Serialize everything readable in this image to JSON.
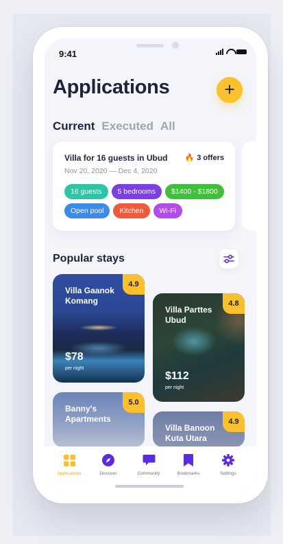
{
  "status_bar": {
    "time": "9:41"
  },
  "header": {
    "title": "Applications",
    "add_label": "+"
  },
  "tabs": [
    {
      "label": "Current",
      "active": true
    },
    {
      "label": "Executed",
      "active": false
    },
    {
      "label": "All",
      "active": false
    }
  ],
  "application_card": {
    "title": "Villa for 16 guests in Ubud",
    "offers": "3 offers",
    "dates": "Nov 20, 2020 — Dec 4, 2020",
    "chips": [
      {
        "label": "16 guests",
        "color": "#2ec4a6"
      },
      {
        "label": "5 bedrooms",
        "color": "#7b3fe4"
      },
      {
        "label": "$1400 - $1800",
        "color": "#3fbf3a"
      },
      {
        "label": "Open pool",
        "color": "#3d8be8"
      },
      {
        "label": "Kitchen",
        "color": "#ef5b3a"
      },
      {
        "label": "Wi-Fi",
        "color": "#b44be8"
      }
    ]
  },
  "popular": {
    "title": "Popular stays",
    "stays": [
      {
        "name": "Villa Gaanok Komang",
        "rating": "4.9",
        "price": "$78",
        "per": "per night"
      },
      {
        "name": "Villa Parttes Ubud",
        "rating": "4.8",
        "price": "$112",
        "per": "per night"
      },
      {
        "name": "Banny's Apartments",
        "rating": "5.0"
      },
      {
        "name": "Villa Banoon Kuta Utara",
        "rating": "4.9"
      }
    ]
  },
  "tabbar": {
    "items": [
      {
        "label": "Applications",
        "icon": "grid-icon"
      },
      {
        "label": "Discover",
        "icon": "compass-icon"
      },
      {
        "label": "Community",
        "icon": "chat-icon"
      },
      {
        "label": "Bookmarks",
        "icon": "bookmark-icon"
      },
      {
        "label": "Settings",
        "icon": "gear-icon"
      }
    ]
  },
  "colors": {
    "accent": "#fbc02d",
    "brand": "#5b2be0",
    "title": "#1f2238"
  }
}
